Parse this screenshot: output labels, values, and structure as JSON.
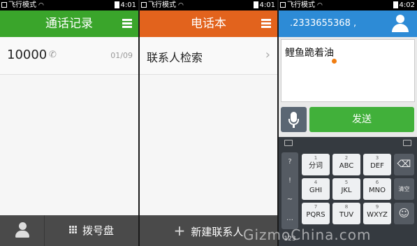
{
  "phone1": {
    "status": {
      "mode": "飞行模式",
      "time": "4:01"
    },
    "title": "通话记录",
    "call_log": [
      {
        "number": "10000",
        "date": "01/09"
      }
    ],
    "bottom": {
      "dialpad_label": "拨号盘"
    }
  },
  "phone2": {
    "status": {
      "mode": "飞行模式",
      "time": "4:01"
    },
    "title": "电话本",
    "search_label": "联系人检索",
    "chevron": "›",
    "bottom": {
      "new_contact_label": "新建联系人",
      "plus": "+"
    }
  },
  "phone3": {
    "status": {
      "mode": "飞行模式",
      "time": "4:02"
    },
    "recipient": ".2333655368 ,",
    "message_text": "鲤鱼跪着油",
    "send_label": "发送",
    "keyboard": {
      "symbols": [
        "?",
        "!",
        "~",
        "…"
      ],
      "keys": [
        {
          "num": "1",
          "label": "分词"
        },
        {
          "num": "2",
          "label": "ABC"
        },
        {
          "num": "3",
          "label": "DEF"
        },
        {
          "num": "4",
          "label": "GHI"
        },
        {
          "num": "5",
          "label": "JKL"
        },
        {
          "num": "6",
          "label": "MNO"
        },
        {
          "num": "7",
          "label": "PQRS"
        },
        {
          "num": "8",
          "label": "TUV"
        },
        {
          "num": "9",
          "label": "WXYZ"
        }
      ],
      "clear_label": "清空",
      "smiley": "☺",
      "bottom_left": "123"
    }
  },
  "watermark": "GizmoChina.com",
  "colors": {
    "green": "#3aa52b",
    "orange": "#e2631d",
    "blue": "#2d8bd6",
    "send_green": "#41b03a",
    "cursor_orange": "#f07d12"
  }
}
